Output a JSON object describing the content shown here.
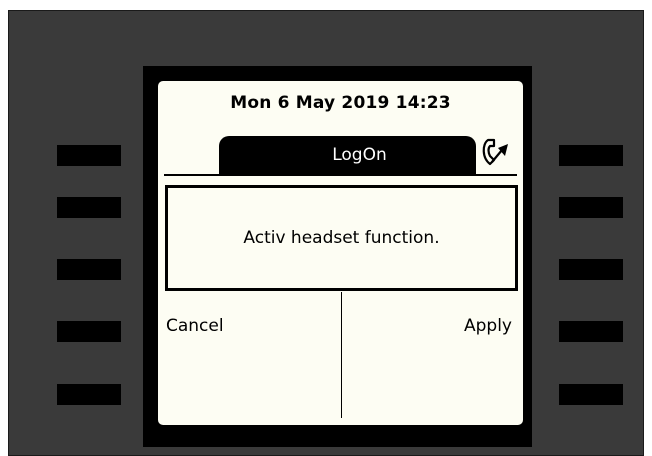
{
  "status": {
    "datetime": "Mon 6 May 2019  14:23"
  },
  "tab": {
    "label": "LogOn"
  },
  "dialog": {
    "message": "Activ headset function."
  },
  "actions": {
    "cancel_label": "Cancel",
    "apply_label": "Apply"
  },
  "icons": {
    "status_icon": "phone-handset-arrow-icon"
  },
  "colors": {
    "screen_bg": "#fdfdf3",
    "device_bg": "#3a3a3a",
    "key": "#000000"
  }
}
